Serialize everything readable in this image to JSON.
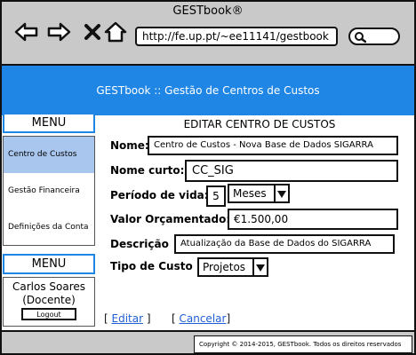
{
  "browser": {
    "window_title": "GESTbook®",
    "url": "http://fe.up.pt/~ee11141/gestbook"
  },
  "app": {
    "header_title": "GESTbook :: Gestão de Centros de Custos"
  },
  "sidebar": {
    "menu_header": "MENU",
    "items": [
      {
        "label": "Centro de Custos",
        "active": true
      },
      {
        "label": "Gestão Financeira",
        "active": false
      },
      {
        "label": "Definições da Conta",
        "active": false
      }
    ],
    "menu_header_2": "MENU",
    "user_name": "Carlos Soares",
    "user_role": "(Docente)",
    "logout_label": "Logout"
  },
  "form": {
    "title": "EDITAR CENTRO DE CUSTOS",
    "nome_label": "Nome:",
    "nome_value": "Centro de Custos - Nova Base de Dados SIGARRA",
    "nome_curto_label": "Nome curto:",
    "nome_curto_value": "CC_SIG",
    "periodo_label": "Período de vida:",
    "periodo_value": "5",
    "periodo_unit": "Meses",
    "valor_label": "Valor Orçamentado:",
    "valor_value": "€1.500,00",
    "descricao_label": "Descrição",
    "descricao_value": "Atualização da Base de Dados do SIGARRA",
    "tipo_label": "Tipo de Custo",
    "tipo_value": "Projetos",
    "editar_label": "Editar",
    "cancelar_label": "Cancelar"
  },
  "footer": {
    "copyright": "Copyright © 2014-2015, GESTbook. Todos os direitos reservados"
  }
}
